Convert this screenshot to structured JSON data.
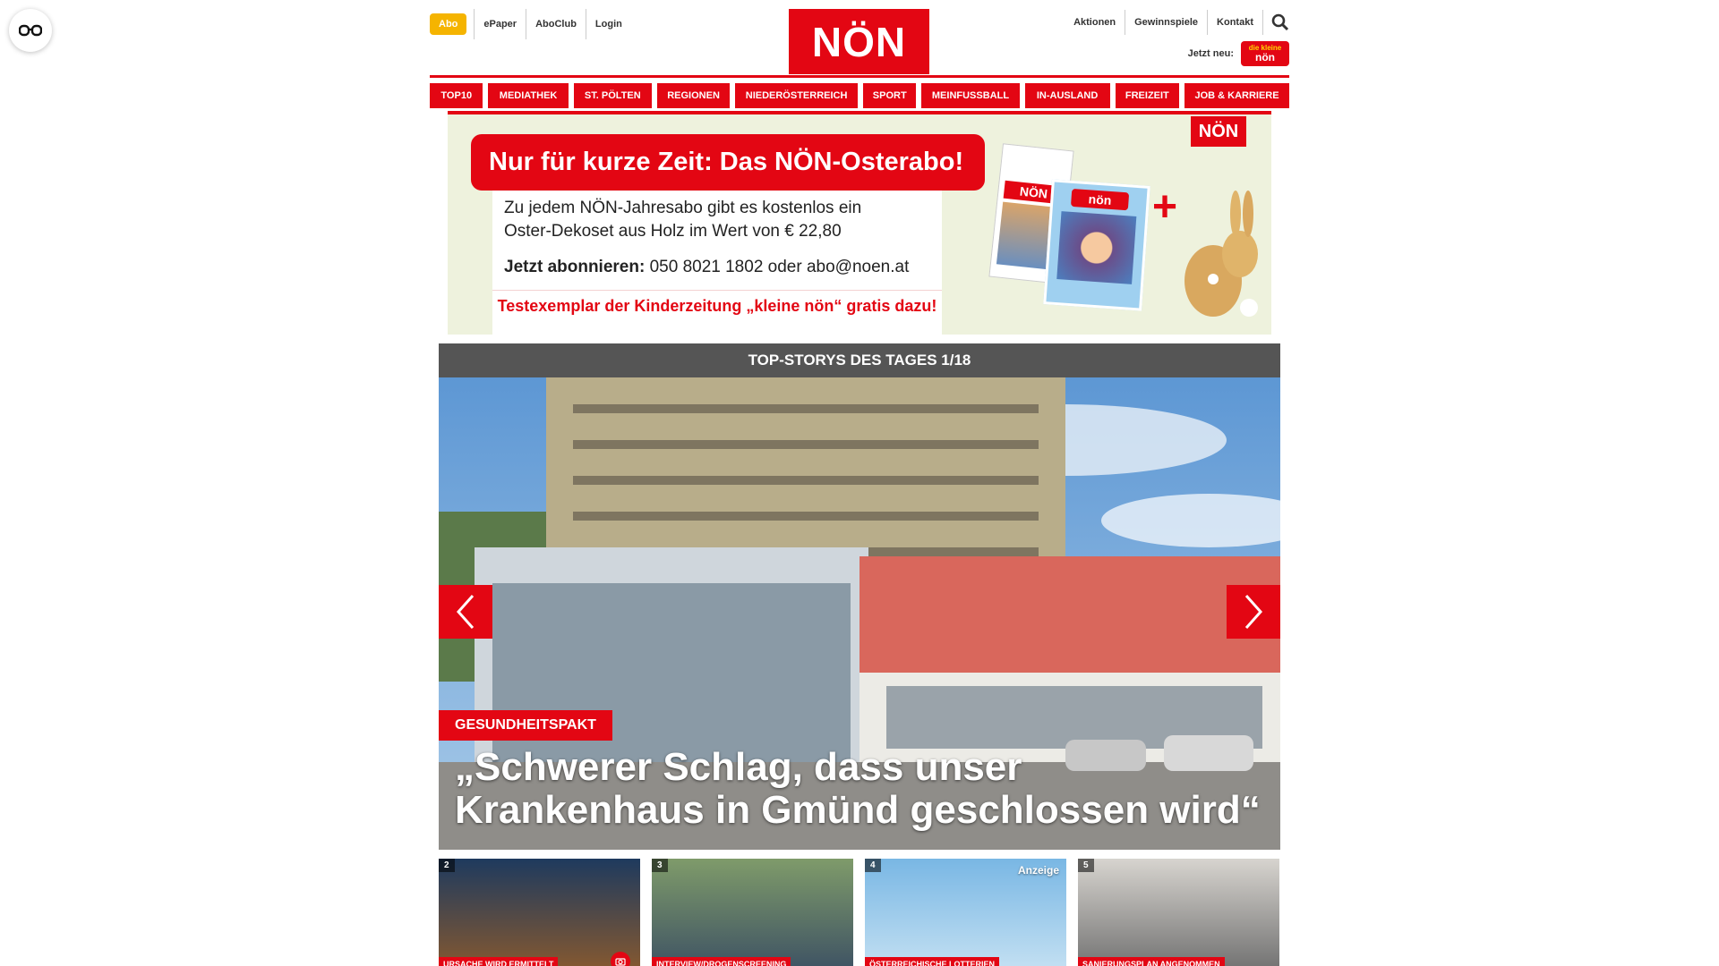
{
  "topnav_left": {
    "abo": "Abo",
    "links": [
      "ePaper",
      "AboClub",
      "Login"
    ]
  },
  "logo": "NÖN",
  "topnav_right": {
    "links": [
      "Aktionen",
      "Gewinnspiele",
      "Kontakt"
    ],
    "jetzt_label": "Jetzt neu:",
    "kleine_logo_top": "die kleine",
    "kleine_logo_bottom": "nön"
  },
  "mainnav": {
    "items": [
      "TOP10",
      "MEDIATHEK",
      "ST. PÖLTEN",
      "REGIONEN",
      "NIEDERÖSTERREICH",
      "SPORT",
      "MEINFUSSBALL",
      "IN-AUSLAND",
      "FREIZEIT",
      "JOB & KARRIERE"
    ]
  },
  "banner": {
    "headline": "Nur für kurze Zeit: Das NÖN-Osterabo!",
    "text_line1": "Zu jedem NÖN-Jahresabo gibt es kostenlos ein",
    "text_line2": "Oster-Dekoset aus Holz im Wert von € 22,80",
    "contact_bold": "Jetzt abonnieren:",
    "contact_rest": " 050 8021 1802 oder abo@noen.at",
    "bottom_line": "Testexemplar der Kinderzeitung „kleine nön“ gratis dazu!",
    "badge": "NÖN",
    "mag1_title": "NÖN",
    "mag2_title": "nön"
  },
  "topstories": {
    "header": "TOP-STORYS DES TAGES 1/18",
    "category": "GESUNDHEITSPAKT",
    "headline": "„Schwerer Schlag, dass unser Krankenhaus in Gmünd geschlossen wird“"
  },
  "cards": [
    {
      "num": "2",
      "tag": "URSACHE WIRD ERMITTELT",
      "anzeige": ""
    },
    {
      "num": "3",
      "tag": "INTERVIEW/DROGENSCREENING",
      "anzeige": ""
    },
    {
      "num": "4",
      "tag": "ÖSTERREICHISCHE LOTTERIEN",
      "anzeige": "Anzeige"
    },
    {
      "num": "5",
      "tag": "SANIERUNGSPLAN ANGENOMMEN",
      "anzeige": ""
    }
  ],
  "colors": {
    "brand_red": "#e30613",
    "abo_yellow": "#f5b400",
    "header_gray": "#555555"
  }
}
